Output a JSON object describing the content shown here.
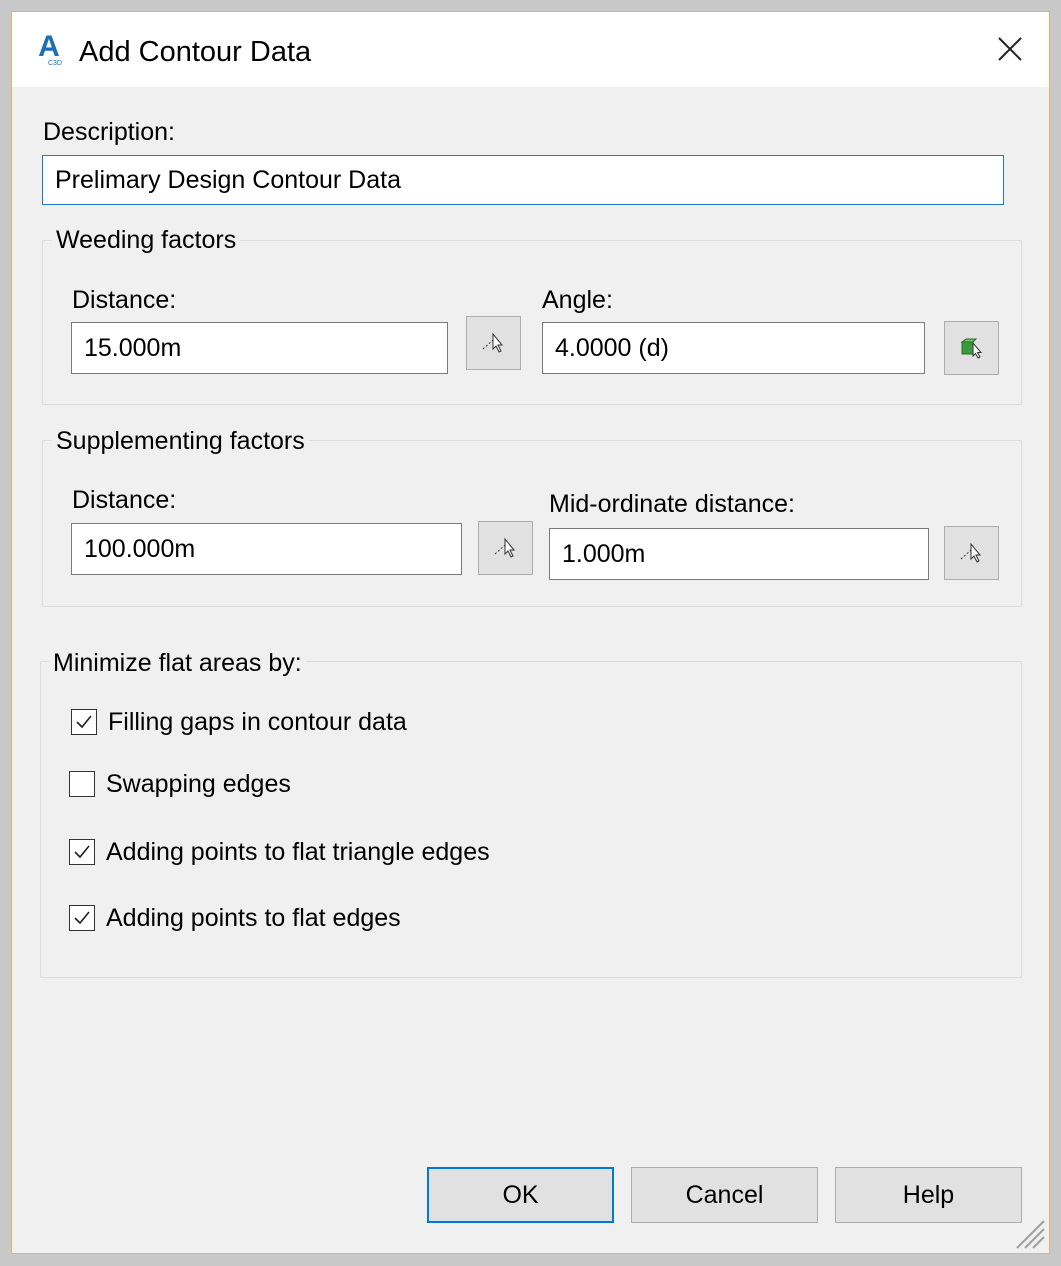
{
  "window": {
    "title": "Add Contour Data",
    "app_icon_letter": "A",
    "app_icon_sub": "C3D",
    "icon": "close-icon"
  },
  "description": {
    "label": "Description:",
    "value": "Prelimary Design Contour Data"
  },
  "weeding": {
    "legend": "Weeding factors",
    "distance_label": "Distance:",
    "distance_value": "15.000m",
    "angle_label": "Angle:",
    "angle_value": "4.0000 (d)"
  },
  "supplementing": {
    "legend": "Supplementing factors",
    "distance_label": "Distance:",
    "distance_value": "100.000m",
    "midordinate_label": "Mid-ordinate distance:",
    "midordinate_value": "1.000m"
  },
  "minimize": {
    "legend": "Minimize flat areas by:",
    "options": [
      {
        "label": "Filling gaps in contour data",
        "checked": true
      },
      {
        "label": "Swapping edges",
        "checked": false
      },
      {
        "label": "Adding points to flat triangle edges",
        "checked": true
      },
      {
        "label": "Adding points to flat edges",
        "checked": true
      }
    ]
  },
  "buttons": {
    "ok": "OK",
    "cancel": "Cancel",
    "help": "Help"
  },
  "colors": {
    "accent": "#0078d7",
    "dialog_bg": "#f0f0f0",
    "border_highlight": "#e4b65c"
  }
}
